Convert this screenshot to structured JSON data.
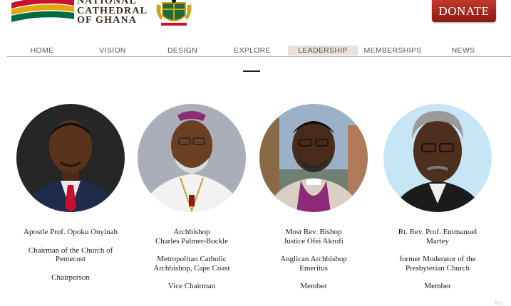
{
  "logo": {
    "line1": "NATIONAL",
    "line2": "CATHEDRAL",
    "line3": "OF GHANA"
  },
  "header": {
    "donate_label": "DONATE"
  },
  "nav": {
    "items": [
      {
        "label": "HOME"
      },
      {
        "label": "VISION"
      },
      {
        "label": "DESIGN"
      },
      {
        "label": "EXPLORE"
      },
      {
        "label": "LEADERSHIP"
      },
      {
        "label": "MEMBERSHIPS"
      },
      {
        "label": "NEWS"
      }
    ],
    "active": "LEADERSHIP"
  },
  "people": [
    {
      "name": "Apostle Prof. Opoku Onyinah",
      "title": "Chairman of the Church of\nPentecost",
      "role": "Chairperson"
    },
    {
      "name": "Archbishop\nCharles  Palmer-Buckle",
      "title": "Metropolitan Catholic\nArchbishop, Cape Coast",
      "role": "Vice Chairman"
    },
    {
      "name": "Most Rev. Bishop\nJustice Ofei Akrofi",
      "title": "Anglican Archbishop\nEmeritus",
      "role": "Member"
    },
    {
      "name": "Rt. Rev. Prof. Emmanuel\nMartey",
      "title": "former Moderator of the\nPresbyterian Church",
      "role": "Member"
    }
  ],
  "watermark": "Acc...",
  "colors": {
    "donate": "#a5261b",
    "active_tab_bg": "#e8e2da",
    "flag_red": "#c8102e",
    "flag_gold": "#e0a800",
    "flag_green": "#006b3f"
  }
}
